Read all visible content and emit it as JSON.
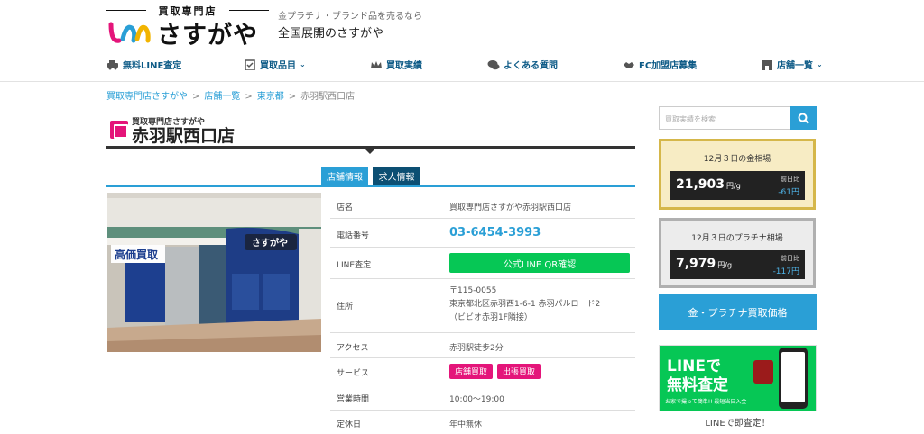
{
  "header": {
    "logo_top": "買取専門店",
    "logo_text": "さすがや",
    "tagline": "金プラチナ・ブランド品を売るなら",
    "tagline2": "全国展開のさすがや"
  },
  "nav": [
    {
      "label": "無料LINE査定",
      "icon": "car-icon"
    },
    {
      "label": "買取品目",
      "icon": "clipboard-icon",
      "dropdown": true
    },
    {
      "label": "買取実績",
      "icon": "crown-icon"
    },
    {
      "label": "よくある質問",
      "icon": "chat-icon"
    },
    {
      "label": "FC加盟店募集",
      "icon": "handshake-icon"
    },
    {
      "label": "店舗一覧",
      "icon": "store-icon",
      "dropdown": true
    }
  ],
  "breadcrumb": [
    "買取専門店さすがや",
    "店舗一覧",
    "東京都",
    "赤羽駅西口店"
  ],
  "store": {
    "sub": "買取専門店さすがや",
    "title": "赤羽駅西口店"
  },
  "tabs": {
    "store_info": "店舗情報",
    "job_info": "求人情報"
  },
  "photo": {
    "sign": "さすがや",
    "banner": "高価買取"
  },
  "info": {
    "name_k": "店名",
    "name_v": "買取専門店さすがや赤羽駅西口店",
    "tel_k": "電話番号",
    "tel_v": "03-6454-3993",
    "line_k": "LINE査定",
    "line_btn": "公式LINE QR確認",
    "addr_k": "住所",
    "addr_zip": "〒115-0055",
    "addr_1": "東京都北区赤羽西1-6-1 赤羽パルロード2",
    "addr_2": "（ビビオ赤羽1F隣接）",
    "access_k": "アクセス",
    "access_v": "赤羽駅徒歩2分",
    "service_k": "サービス",
    "service_1": "店舗買取",
    "service_2": "出張買取",
    "hours_k": "営業時間",
    "hours_v": "10:00～19:00",
    "holiday_k": "定休日",
    "holiday_v": "年中無休"
  },
  "sidebar": {
    "search_placeholder": "買取実績を検索",
    "gold": {
      "heading": "12月３日の金相場",
      "price": "21,903",
      "unit": "円/g",
      "prev_label": "前日比",
      "diff": "-61円"
    },
    "platinum": {
      "heading": "12月３日のプラチナ相場",
      "price": "7,979",
      "unit": "円/g",
      "prev_label": "前日比",
      "diff": "-117円"
    },
    "gp_button": "金・プラチナ買取価格",
    "line_banner": {
      "t1": "LINEで",
      "t2": "無料査定",
      "t3": "お家で撮って簡単!! 最短当日入金"
    },
    "line_caption": "LINEで即査定！"
  },
  "colors": {
    "accent": "#2a9fd6",
    "navy": "#0c4f73",
    "pink": "#e4157a",
    "line_green": "#06c755"
  }
}
